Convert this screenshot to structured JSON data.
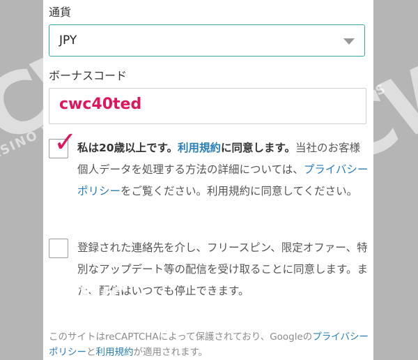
{
  "watermark": {
    "big_left": "CWC",
    "big_right": "CWC",
    "small_left": "CASINO WINNER'S CLUB",
    "small_right": "CASINO WINNER'S CLUB",
    "logo_top": "CASINO",
    "logo_mid": "CWC",
    "logo_bot": "WINNER'S CLUB"
  },
  "form": {
    "currency_label": "通貨",
    "currency_value": "JPY",
    "bonus_label": "ボーナスコード",
    "bonus_value": "cwc40ted",
    "age_checked": true,
    "age_bold_1": "私は20歳以上です。",
    "age_terms_link": "利用規約",
    "age_bold_2": "に同意します。",
    "age_rest_1": "当社のお客様個人データを処理する方法の詳細については、",
    "age_privacy_link": "プライバシーポリシー",
    "age_rest_2": "をご覧ください。利用規約に同意してください。",
    "marketing_checked": false,
    "marketing_text": "登録された連絡先を介し、フリースピン、限定オファー、特別なアップデート等の配信を受け取ることに同意します。また、配信はいつでも停止できます。",
    "recaptcha_text_1": "このサイトはreCAPTCHAによって保護されており、Googleの",
    "recaptcha_privacy_link": "プライバシーポリシー",
    "recaptcha_and": "と",
    "recaptcha_terms_link": "利用規約",
    "recaptcha_text_2": "が適用されます。"
  }
}
